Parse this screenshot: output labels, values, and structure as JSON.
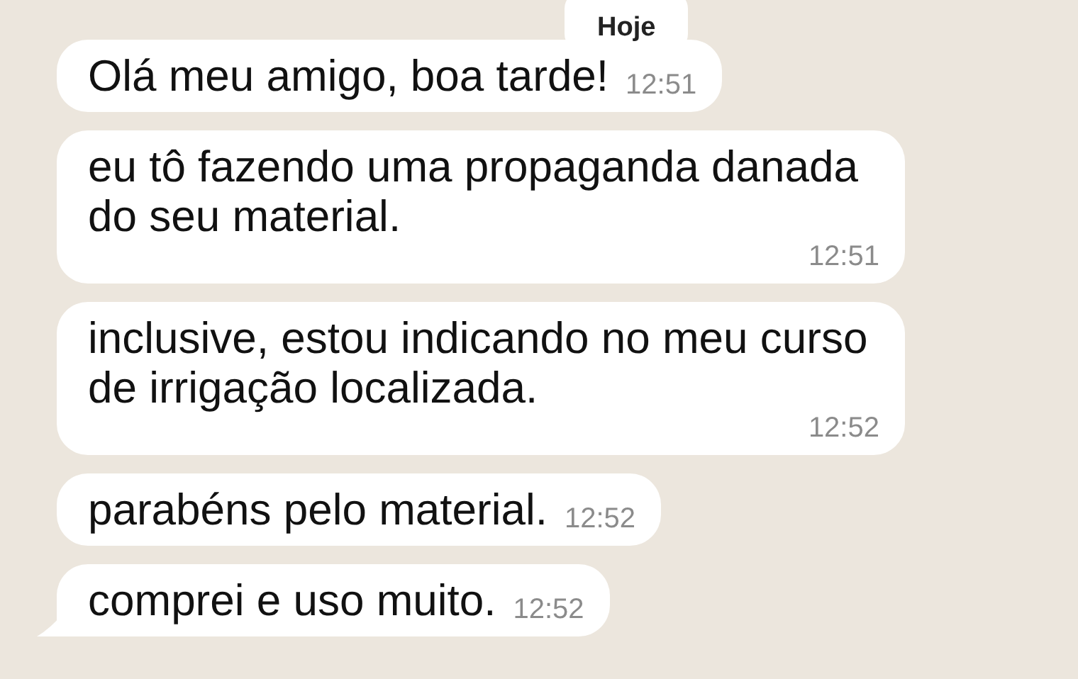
{
  "date_label": "Hoje",
  "messages": [
    {
      "text": "Olá meu amigo, boa tarde!",
      "time": "12:51",
      "tail": false
    },
    {
      "text": "eu tô fazendo uma propaganda danada do seu material.",
      "time": "12:51",
      "tail": false
    },
    {
      "text": "inclusive, estou indicando no meu curso de irrigação localizada.",
      "time": "12:52",
      "tail": false
    },
    {
      "text": "parabéns pelo material.",
      "time": "12:52",
      "tail": false
    },
    {
      "text": "comprei e uso muito.",
      "time": "12:52",
      "tail": true
    }
  ]
}
